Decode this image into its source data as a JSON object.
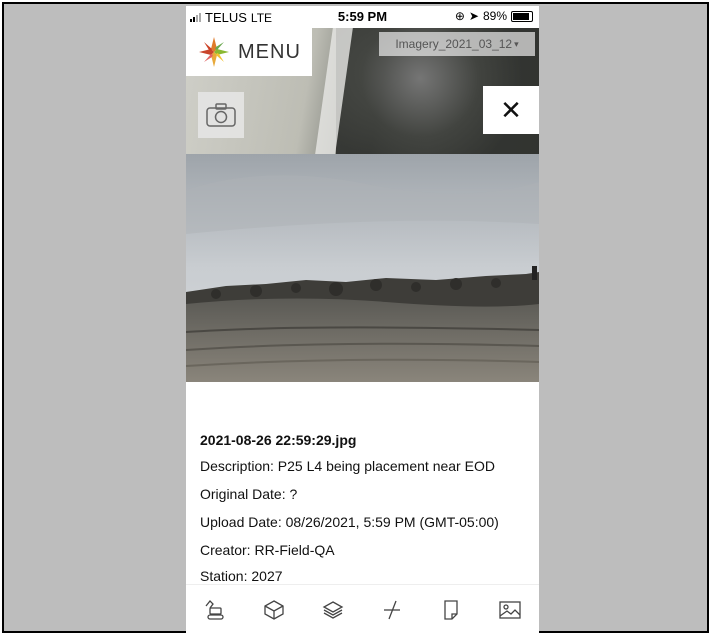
{
  "status_bar": {
    "carrier": "TELUS",
    "network": "LTE",
    "time": "5:59 PM",
    "battery": "89%"
  },
  "map": {
    "menu_label": "MENU",
    "imagery_label": "Imagery_2021_03_12"
  },
  "photo_info": {
    "filename": "2021-08-26 22:59:29.jpg",
    "description": "Description: P25 L4 being placement near EOD",
    "original_date": "Original Date: ?",
    "upload_date": "Upload Date: 08/26/2021, 5:59 PM (GMT-05:00)",
    "creator": "Creator: RR-Field-QA",
    "station": "Station: 2027"
  },
  "toolbar": {
    "items": [
      "excavator-icon",
      "cube-icon",
      "layers-icon",
      "measure-icon",
      "note-icon",
      "image-icon"
    ]
  }
}
